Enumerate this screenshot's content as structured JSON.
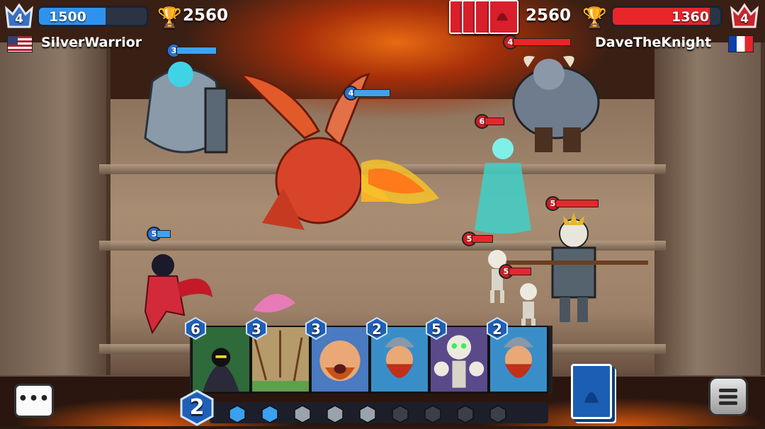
{
  "player": {
    "level": "4",
    "health": "1500",
    "health_fraction": 0.62,
    "trophies": "2560",
    "name": "SilverWarrior",
    "flag": "us-flag-icon"
  },
  "opponent": {
    "level": "4",
    "health": "1360",
    "health_fraction": 0.9,
    "trophies": "2560",
    "name": "DaveTheKnight",
    "flag": "france-flag-icon",
    "cards_in_hand": 4
  },
  "units": [
    {
      "name": "armored-knight",
      "level": "3",
      "team": "blue",
      "health_fraction": 0.95
    },
    {
      "name": "red-dragon",
      "level": "4",
      "team": "blue",
      "health_fraction": 0.9
    },
    {
      "name": "ninja-girl",
      "level": "5",
      "team": "blue",
      "health_fraction": 0.35
    },
    {
      "name": "minotaur",
      "level": "4",
      "team": "red",
      "health_fraction": 0.95
    },
    {
      "name": "ghost-lady",
      "level": "6",
      "team": "red",
      "health_fraction": 0.4
    },
    {
      "name": "skeleton-king",
      "level": "5",
      "team": "red",
      "health_fraction": 0.95
    },
    {
      "name": "skeleton-warrior",
      "level": "5",
      "team": "red",
      "health_fraction": 0.45
    },
    {
      "name": "skeleton-minion",
      "level": "5",
      "team": "red",
      "health_fraction": 0.6
    }
  ],
  "hand": [
    {
      "name": "assassin",
      "cost": "6"
    },
    {
      "name": "arrow-rain",
      "cost": "3"
    },
    {
      "name": "barbarian",
      "cost": "3"
    },
    {
      "name": "viking",
      "cost": "2"
    },
    {
      "name": "skeletons",
      "cost": "5"
    },
    {
      "name": "viking",
      "cost": "2"
    }
  ],
  "mana": {
    "current": "2",
    "max_pips": 9,
    "filled_pips": 2
  },
  "colors": {
    "player_health": "#2f93ee",
    "opponent_health": "#e8262a",
    "mana": "#3aa0f0"
  },
  "buttons": {
    "chat": "•••",
    "chat_icon": "chat-bubble-icon",
    "menu_icon": "hamburger-menu-icon",
    "deck_icon": "deck-icon"
  }
}
